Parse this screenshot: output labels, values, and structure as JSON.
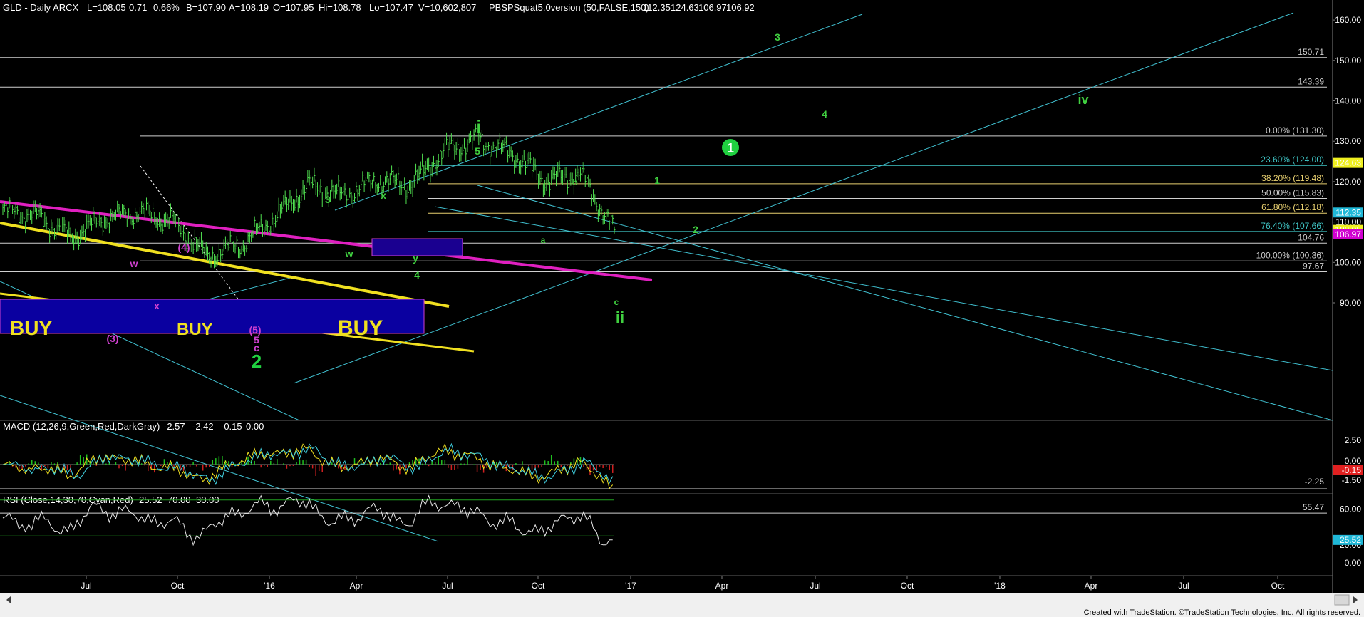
{
  "header": {
    "symbol": "GLD - Daily  ARCX",
    "last": "L=108.05",
    "change": "0.71",
    "change_pct": "0.66%",
    "bid": "B=107.90",
    "ask": "A=108.19",
    "open": "O=107.95",
    "high": "Hi=108.78",
    "low": "Lo=107.47",
    "volume": "V=10,602,807",
    "indicator": "PBSPSquat5.0version (50,FALSE,150)",
    "ind_values": [
      "112.35",
      "124.63",
      "106.97",
      "106.92"
    ],
    "ind_colors": [
      "#4fd5e8",
      "#e8e84a",
      "#d84be0",
      "#4fd5e8"
    ]
  },
  "price_axis": {
    "ticks": [
      "160.00",
      "150.00",
      "140.00",
      "130.00",
      "120.00",
      "110.00",
      "100.00",
      "90.00"
    ],
    "tick_values": [
      160,
      150,
      140,
      130,
      120,
      110,
      100,
      90
    ],
    "badges": [
      {
        "text": "124.63",
        "bg": "#f0f020",
        "fg": "#000000",
        "value": 124.63
      },
      {
        "text": "112.35",
        "bg": "#20b8d8",
        "fg": "#ffffff",
        "value": 112.35
      },
      {
        "text": "108.05",
        "bg": "#f0f020",
        "fg": "#000000",
        "value": 108.05
      },
      {
        "text": "106.97",
        "bg": "#d000d0",
        "fg": "#ffffff",
        "value": 106.97
      }
    ]
  },
  "fib_levels": [
    {
      "label": "150.71",
      "value": 150.71,
      "color": "#d0d0d0"
    },
    {
      "label": "143.39",
      "value": 143.39,
      "color": "#d0d0d0"
    },
    {
      "label": "0.00% (131.30)",
      "value": 131.3,
      "color": "#d0d0d0"
    },
    {
      "label": "23.60% (124.00)",
      "value": 124.0,
      "color": "#40c8c8"
    },
    {
      "label": "38.20% (119.48)",
      "value": 119.48,
      "color": "#e8d070"
    },
    {
      "label": "50.00% (115.83)",
      "value": 115.83,
      "color": "#d0d0d0"
    },
    {
      "label": "61.80% (112.18)",
      "value": 112.18,
      "color": "#e8d070"
    },
    {
      "label": "76.40% (107.66)",
      "value": 107.66,
      "color": "#40c8c8"
    },
    {
      "label": "104.76",
      "value": 104.76,
      "color": "#d0d0d0"
    },
    {
      "label": "100.00% (100.36)",
      "value": 100.36,
      "color": "#d0d0d0"
    },
    {
      "label": "97.67",
      "value": 97.67,
      "color": "#d0d0d0"
    }
  ],
  "time_axis": {
    "labels": [
      "Jul",
      "Oct",
      "'16",
      "Apr",
      "Jul",
      "Oct",
      "'17",
      "Apr",
      "Jul",
      "Oct",
      "'18",
      "Apr",
      "Jul",
      "Oct"
    ]
  },
  "buy_labels": [
    "BUY",
    "BUY",
    "BUY"
  ],
  "waves": [
    {
      "t": "(3)",
      "c": "#d040d0",
      "s": 14
    },
    {
      "t": "(4)",
      "c": "#d040d0",
      "s": 14
    },
    {
      "t": "w",
      "c": "#d040d0",
      "s": 14
    },
    {
      "t": "x",
      "c": "#d040d0",
      "s": 14
    },
    {
      "t": "(5)",
      "c": "#d040d0",
      "s": 14
    },
    {
      "t": "5",
      "c": "#d040d0",
      "s": 14
    },
    {
      "t": "c",
      "c": "#d040d0",
      "s": 14
    },
    {
      "t": "2",
      "c": "#20d040",
      "s": 26
    },
    {
      "t": "3",
      "c": "#40d040",
      "s": 14
    },
    {
      "t": "w",
      "c": "#40d040",
      "s": 14
    },
    {
      "t": "x",
      "c": "#40d040",
      "s": 14
    },
    {
      "t": "y",
      "c": "#40d040",
      "s": 14
    },
    {
      "t": "4",
      "c": "#40d040",
      "s": 14
    },
    {
      "t": "5",
      "c": "#40d040",
      "s": 14
    },
    {
      "t": "i",
      "c": "#40d040",
      "s": 26
    },
    {
      "t": "a",
      "c": "#40d040",
      "s": 12
    },
    {
      "t": "b",
      "c": "#40d040",
      "s": 12
    },
    {
      "t": "c",
      "c": "#40d040",
      "s": 12
    },
    {
      "t": "ii",
      "c": "#40d040",
      "s": 22
    },
    {
      "t": "1",
      "c": "#40d040",
      "s": 14
    },
    {
      "t": "2",
      "c": "#40d040",
      "s": 14
    },
    {
      "t": "3",
      "c": "#40d040",
      "s": 14
    },
    {
      "t": "4",
      "c": "#40d040",
      "s": 14
    },
    {
      "t": "iv",
      "c": "#40d040",
      "s": 18
    }
  ],
  "circle_one": "1",
  "macd": {
    "title": "MACD (12,26,9,Green,Red,DarkGray)",
    "v1": "-2.57",
    "v2": "-2.42",
    "v3": "-0.15",
    "v4": "0.00",
    "ticks": [
      "2.50",
      "0.00",
      "-1.50"
    ],
    "line_label": "-2.25",
    "badge": "-0.15"
  },
  "rsi": {
    "title": "RSI (Close,14,30,70,Cyan,Red)",
    "v1": "25.52",
    "v2": "70.00",
    "v3": "30.00",
    "ticks": [
      "60.00",
      "20.00",
      "0.00"
    ],
    "line_label": "55.47",
    "badge": "25.52"
  },
  "footer": "Created with TradeStation. ©TradeStation Technologies, Inc. All rights reserved.",
  "chart_data": {
    "type": "line",
    "title": "GLD - Daily ARCX",
    "series": [
      {
        "name": "GLD Daily Close",
        "x": [
          "2015-06",
          "2015-07",
          "2015-08",
          "2015-09",
          "2015-10",
          "2015-11",
          "2015-12",
          "2016-01",
          "2016-02",
          "2016-03",
          "2016-04",
          "2016-05",
          "2016-06",
          "2016-07",
          "2016-08",
          "2016-09",
          "2016-10",
          "2016-11",
          "2016-12"
        ],
        "values": [
          113.0,
          111.5,
          106.0,
          111.0,
          112.5,
          110.0,
          101.5,
          104.5,
          111.0,
          119.0,
          116.5,
          120.5,
          119.0,
          127.5,
          130.5,
          127.0,
          120.0,
          122.0,
          108.05
        ]
      }
    ],
    "ylim": [
      80,
      165
    ],
    "yticks": [
      90,
      100,
      110,
      120,
      130,
      140,
      150,
      160
    ]
  }
}
